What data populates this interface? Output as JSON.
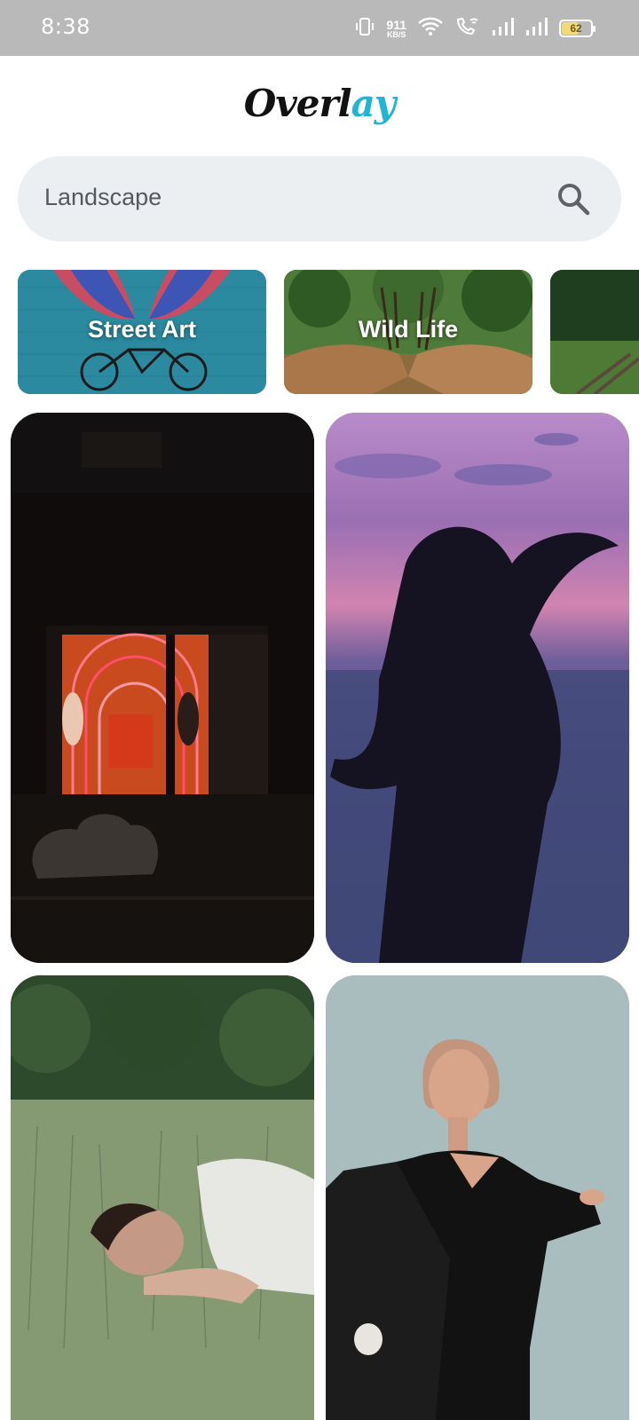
{
  "status_bar": {
    "time": "8:38",
    "net_speed_value": "911",
    "net_speed_unit": "KB/S",
    "battery_level": "62",
    "battery_fraction": 0.62,
    "icons": [
      "vibrate-icon",
      "wifi-icon",
      "wifi-calling-icon",
      "signal-icon",
      "signal-icon",
      "battery-icon"
    ]
  },
  "logo": {
    "part1": "Overl",
    "part2": "ay",
    "accent_color": "#1fb5d6"
  },
  "search": {
    "value": "Landscape",
    "icon": "search-icon"
  },
  "categories": [
    {
      "label": "Street Art"
    },
    {
      "label": "Wild Life"
    },
    {
      "label": ""
    }
  ],
  "photos": [
    {
      "name": "neon-storefront-photo"
    },
    {
      "name": "woman-wind-hair-photo"
    },
    {
      "name": "woman-lying-grass-photo"
    },
    {
      "name": "woman-black-blazer-photo"
    }
  ]
}
